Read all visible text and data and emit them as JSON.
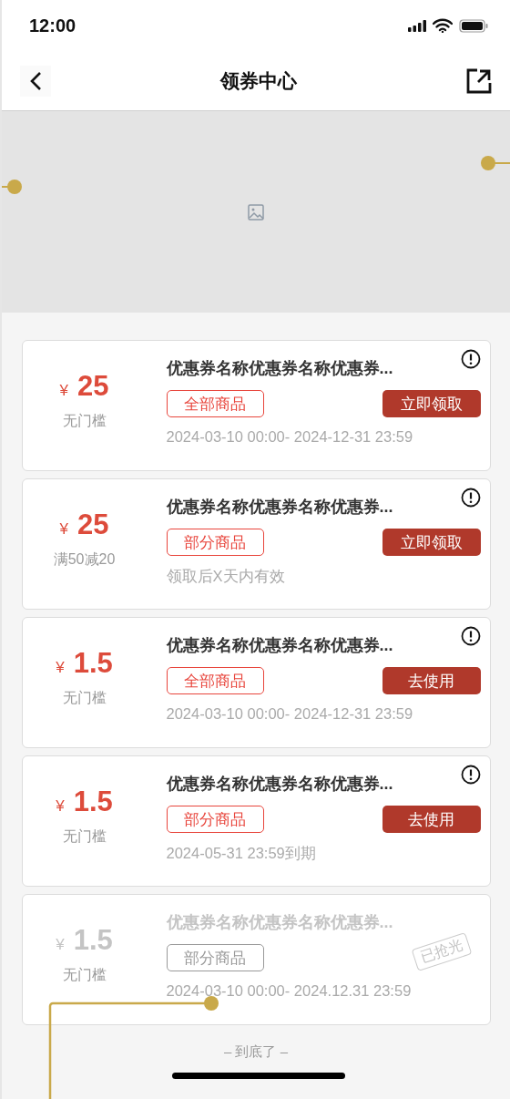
{
  "status_bar": {
    "time": "12:00"
  },
  "nav": {
    "title": "领券中心"
  },
  "coupons": [
    {
      "currency": "¥",
      "amount": "25",
      "condition": "无门槛",
      "name": "优惠券名称优惠券名称优惠券...",
      "scope": "全部商品",
      "action": "立即领取",
      "validity": "2024-03-10 00:00- 2024-12-31 23:59",
      "sold_out": false
    },
    {
      "currency": "¥",
      "amount": "25",
      "condition": "满50减20",
      "name": "优惠券名称优惠券名称优惠券...",
      "scope": "部分商品",
      "action": "立即领取",
      "validity": "领取后X天内有效",
      "sold_out": false
    },
    {
      "currency": "¥",
      "amount": "1.5",
      "condition": "无门槛",
      "name": "优惠券名称优惠券名称优惠券...",
      "scope": "全部商品",
      "action": "去使用",
      "validity": "2024-03-10 00:00- 2024-12-31 23:59",
      "sold_out": false
    },
    {
      "currency": "¥",
      "amount": "1.5",
      "condition": "无门槛",
      "name": "优惠券名称优惠券名称优惠券...",
      "scope": "部分商品",
      "action": "去使用",
      "validity": "2024-05-31 23:59到期",
      "sold_out": false
    },
    {
      "currency": "¥",
      "amount": "1.5",
      "condition": "无门槛",
      "name": "优惠券名称优惠券名称优惠券...",
      "scope": "部分商品",
      "stamp": "已抢光",
      "validity": "2024-03-10 00:00- 2024.12.31 23:59",
      "sold_out": true
    }
  ],
  "footer": {
    "end_text": "– 到底了 –"
  }
}
